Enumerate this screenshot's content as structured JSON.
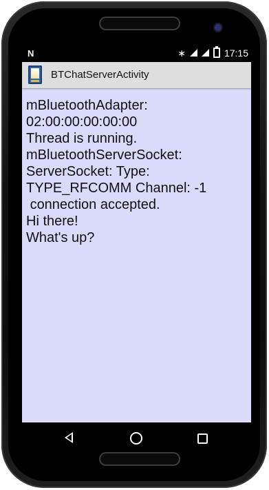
{
  "status_bar": {
    "left_icon": "N",
    "time": "17:15",
    "icons": [
      "bluetooth-icon",
      "signal-icon",
      "wifi-icon",
      "battery-icon"
    ]
  },
  "action_bar": {
    "title": "BTChatServerActivity",
    "icon": "app-icon"
  },
  "content": {
    "text": "mBluetoothAdapter:\n02:00:00:00:00:00\nThread is running.\nmBluetoothServerSocket:\nServerSocket: Type:\nTYPE_RFCOMM Channel: -1\n connection accepted.\nHi there!\nWhat's up?"
  },
  "navigation": {
    "back": "back-icon",
    "home": "home-icon",
    "recent": "recent-apps-icon"
  },
  "colors": {
    "content_background": "#dadafb",
    "action_bar_background": "#dedede",
    "device_body": "#111111"
  }
}
